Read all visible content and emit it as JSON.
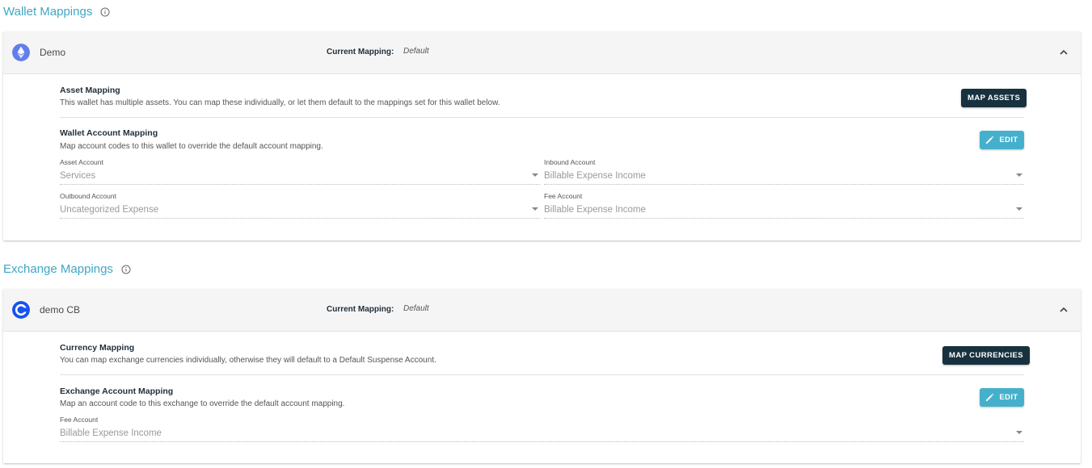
{
  "wallet_section": {
    "title": "Wallet Mappings",
    "card": {
      "name": "Demo",
      "current_mapping_label": "Current Mapping:",
      "current_mapping_value": "Default",
      "asset_mapping": {
        "title": "Asset Mapping",
        "description": "This wallet has multiple assets. You can map these individually, or let them default to the mappings set for this wallet below.",
        "button_label": "MAP ASSETS"
      },
      "account_mapping": {
        "title": "Wallet Account Mapping",
        "description": "Map account codes to this wallet to override the default account mapping.",
        "edit_label": "EDIT",
        "fields": [
          {
            "label": "Asset Account",
            "value": "Services"
          },
          {
            "label": "Inbound Account",
            "value": "Billable Expense Income"
          },
          {
            "label": "Outbound Account",
            "value": "Uncategorized Expense"
          },
          {
            "label": "Fee Account",
            "value": "Billable Expense Income"
          }
        ]
      }
    }
  },
  "exchange_section": {
    "title": "Exchange Mappings",
    "card": {
      "name": "demo CB",
      "current_mapping_label": "Current Mapping:",
      "current_mapping_value": "Default",
      "currency_mapping": {
        "title": "Currency Mapping",
        "description": "You can map exchange currencies individually, otherwise they will default to a Default Suspense Account.",
        "button_label": "MAP CURRENCIES"
      },
      "account_mapping": {
        "title": "Exchange Account Mapping",
        "description": "Map an account code to this exchange to override the default account mapping.",
        "edit_label": "EDIT",
        "fields": [
          {
            "label": "Fee Account",
            "value": "Billable Expense Income"
          }
        ]
      }
    }
  },
  "colors": {
    "accent": "#3fa7c4",
    "dark_button": "#17313f",
    "edit_button": "#45b0cc",
    "ethereum": "#627eea",
    "coinbase": "#1652f0"
  },
  "icons": [
    "info-icon",
    "ethereum-icon",
    "coinbase-icon",
    "chevron-up-icon",
    "pencil-icon",
    "dropdown-caret-icon"
  ]
}
